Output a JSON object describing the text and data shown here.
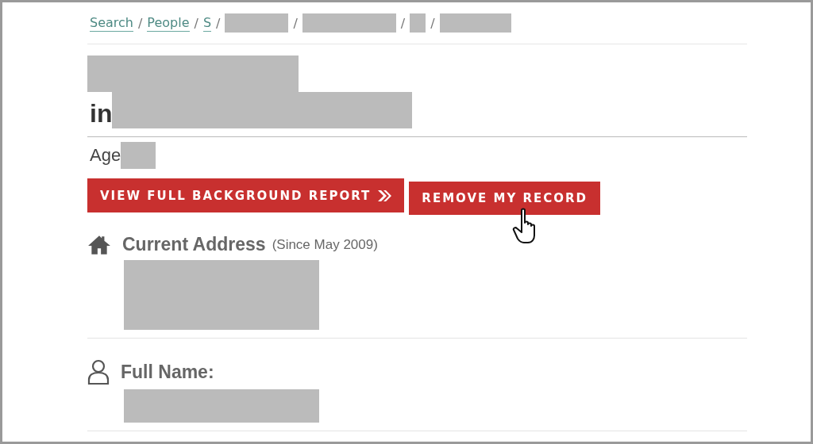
{
  "breadcrumbs": [
    {
      "kind": "link",
      "text": "Search"
    },
    {
      "kind": "link",
      "text": "People",
      "separator": "/"
    },
    {
      "kind": "link",
      "text": "S",
      "separator": "/"
    },
    {
      "kind": "redacted",
      "separator": "/"
    },
    {
      "kind": "redacted",
      "separator": "/"
    },
    {
      "kind": "redacted",
      "separator": "/"
    },
    {
      "kind": "redacted",
      "separator": "/"
    }
  ],
  "heading": {
    "prefix": "in"
  },
  "age_label": "Age",
  "buttons": [
    {
      "kind": "report",
      "text": "VIEW FULL BACKGROUND REPORT"
    },
    {
      "kind": "remove",
      "text": "REMOVE MY RECORD"
    }
  ],
  "sections": [
    {
      "kind": "home",
      "title": "Current Address",
      "note": "(Since May 2009)"
    },
    {
      "kind": "person",
      "title": "Full Name:"
    }
  ]
}
